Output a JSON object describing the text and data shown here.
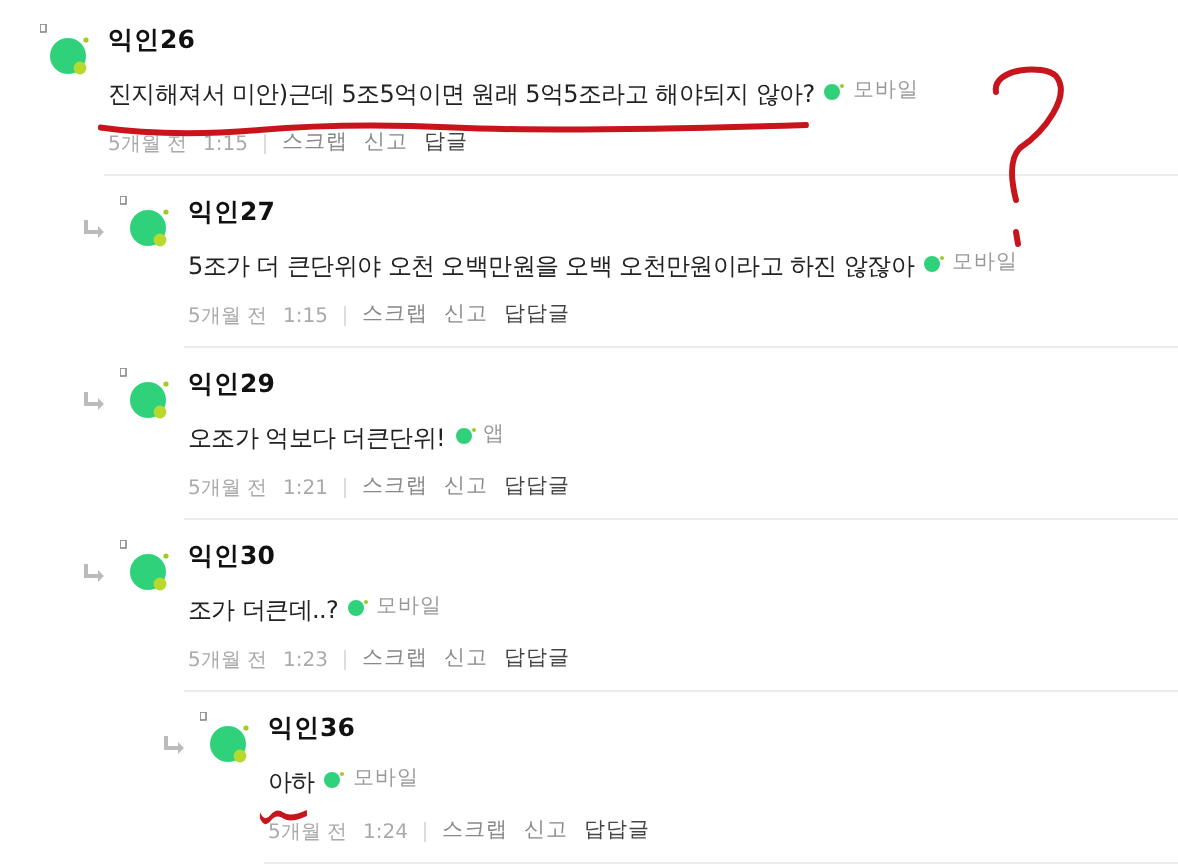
{
  "comments": [
    {
      "author": "익인26",
      "text": "진지해져서 미안)근데 5조5억이면 원래 5억5조라고 해야되지 않아?",
      "device": "모바일",
      "age": "5개월 전",
      "time": "1:15",
      "actions": [
        "스크랩",
        "신고"
      ],
      "reply_link": "답글",
      "underlined": true,
      "children": [
        {
          "author": "익인27",
          "text": "5조가 더 큰단위야 오천 오백만원을 오백 오천만원이라고 하진 않잖아",
          "device": "모바일",
          "age": "5개월 전",
          "time": "1:15",
          "actions": [
            "스크랩",
            "신고"
          ],
          "reply_link": "답답글",
          "underlined": false
        },
        {
          "author": "익인29",
          "text": "오조가 억보다 더큰단위!",
          "device": "앱",
          "age": "5개월 전",
          "time": "1:21",
          "actions": [
            "스크랩",
            "신고"
          ],
          "reply_link": "답답글",
          "underlined": false
        },
        {
          "author": "익인30",
          "text": "조가 더큰데..?",
          "device": "모바일",
          "age": "5개월 전",
          "time": "1:23",
          "actions": [
            "스크랩",
            "신고"
          ],
          "reply_link": "답답글",
          "underlined": false,
          "children": [
            {
              "author": "익인36",
              "text": "아하",
              "device": "모바일",
              "age": "5개월 전",
              "time": "1:24",
              "actions": [
                "스크랩",
                "신고"
              ],
              "reply_link": "답답글",
              "underlined": true
            }
          ]
        }
      ]
    }
  ],
  "question_mark": true
}
